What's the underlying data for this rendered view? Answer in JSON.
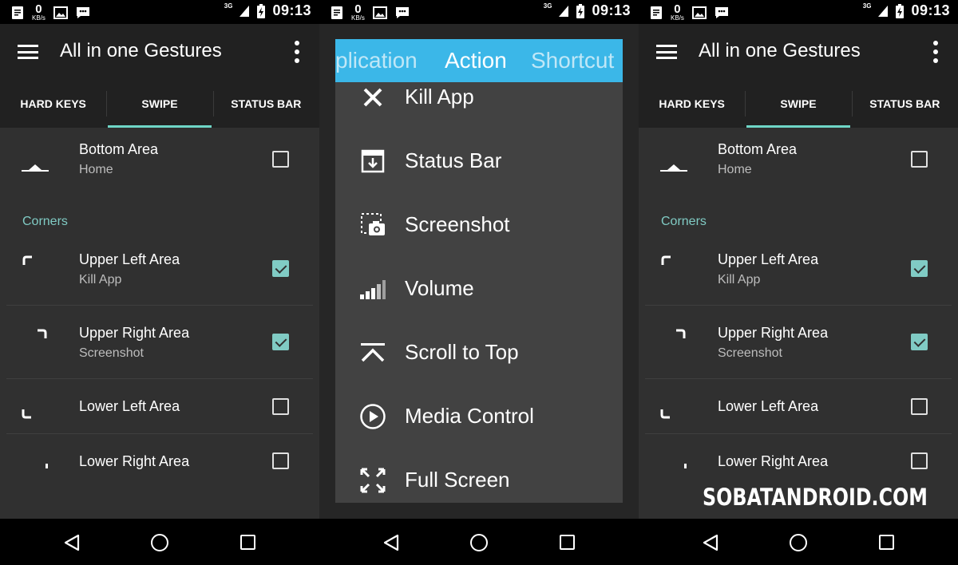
{
  "status_bar": {
    "kbs_value": "0",
    "kbs_unit": "KB/s",
    "network": "3G",
    "time": "09:13"
  },
  "app": {
    "title": "All in one Gestures",
    "tabs": [
      "HARD KEYS",
      "SWIPE",
      "STATUS BAR"
    ],
    "active_tab": "SWIPE"
  },
  "gestures": {
    "bottom_area": {
      "title": "Bottom Area",
      "action": "Home",
      "checked": false
    },
    "section_corners": "Corners",
    "upper_left": {
      "title": "Upper Left Area",
      "action": "Kill App",
      "checked": true
    },
    "upper_right": {
      "title": "Upper Right Area",
      "action": "Screenshot",
      "checked": true
    },
    "lower_left": {
      "title": "Lower Left Area",
      "checked": false
    },
    "lower_right": {
      "title": "Lower Right Area",
      "checked": false
    }
  },
  "dialog": {
    "tabs": [
      "plication",
      "Action",
      "Shortcut"
    ],
    "active_tab": "Action",
    "items": [
      {
        "label": "Kill App",
        "icon": "close-icon"
      },
      {
        "label": "Status Bar",
        "icon": "status-bar-icon"
      },
      {
        "label": "Screenshot",
        "icon": "screenshot-icon"
      },
      {
        "label": "Volume",
        "icon": "volume-icon"
      },
      {
        "label": "Scroll to Top",
        "icon": "scroll-top-icon"
      },
      {
        "label": "Media Control",
        "icon": "play-icon"
      },
      {
        "label": "Full Screen",
        "icon": "fullscreen-icon"
      }
    ]
  },
  "watermark": "SOBATANDROID.COM",
  "colors": {
    "accent": "#80cbc4",
    "dialog_header": "#3bb7e8",
    "app_bar": "#212121",
    "background": "#303030"
  }
}
